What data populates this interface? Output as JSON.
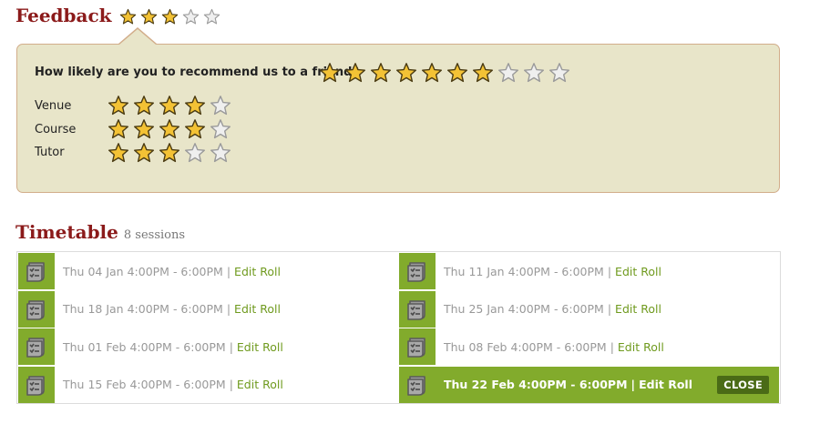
{
  "feedback": {
    "title": "Feedback",
    "summary_rating": 3,
    "summary_max": 5,
    "recommend_question": "How likely are you to recommend us to a friend?",
    "recommend_rating": 7,
    "recommend_max": 10,
    "ratings": [
      {
        "label": "Venue",
        "value": 4,
        "max": 5
      },
      {
        "label": "Course",
        "value": 4,
        "max": 5
      },
      {
        "label": "Tutor",
        "value": 3,
        "max": 5
      }
    ]
  },
  "timetable": {
    "title": "Timetable",
    "subtitle": "8 sessions",
    "separator": "|",
    "edit_label": "Edit Roll",
    "close_label": "CLOSE",
    "sessions": [
      {
        "text": "Thu 04 Jan 4:00PM - 6:00PM",
        "active": false
      },
      {
        "text": "Thu 11 Jan 4:00PM - 6:00PM",
        "active": false
      },
      {
        "text": "Thu 18 Jan 4:00PM - 6:00PM",
        "active": false
      },
      {
        "text": "Thu 25 Jan 4:00PM - 6:00PM",
        "active": false
      },
      {
        "text": "Thu 01 Feb 4:00PM - 6:00PM",
        "active": false
      },
      {
        "text": "Thu 08 Feb 4:00PM - 6:00PM",
        "active": false
      },
      {
        "text": "Thu 15 Feb 4:00PM - 6:00PM",
        "active": false
      },
      {
        "text": "Thu 22 Feb 4:00PM - 6:00PM",
        "active": true
      }
    ]
  },
  "colors": {
    "title": "#8b1a1a",
    "panel_bg": "#e8e5c9",
    "accent_green": "#82ab2c",
    "star_filled": "#f3c235",
    "star_empty": "#cfcfcf"
  }
}
